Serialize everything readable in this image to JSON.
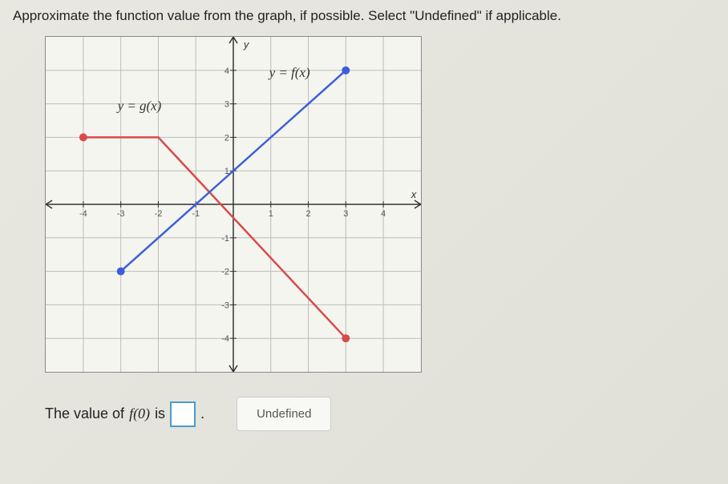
{
  "question": "Approximate the function value from the graph, if possible. Select \"Undefined\" if applicable.",
  "answer_prefix": "The value of ",
  "answer_func": "f(0)",
  "answer_mid": " is ",
  "answer_suffix": ".",
  "undefined_label": "Undefined",
  "chart_data": {
    "type": "line",
    "xlabel": "x",
    "ylabel": "y",
    "xlim": [
      -5,
      5
    ],
    "ylim": [
      -5,
      5
    ],
    "x_ticks": [
      -4,
      -3,
      -2,
      -1,
      1,
      2,
      3,
      4
    ],
    "y_ticks": [
      -4,
      -3,
      -2,
      -1,
      1,
      2,
      3,
      4
    ],
    "series": [
      {
        "name": "y = f(x)",
        "label_pos": [
          1.2,
          3.8
        ],
        "color": "#3b5fd9",
        "points": [
          [
            -3,
            -2
          ],
          [
            3,
            4
          ]
        ],
        "endpoints": [
          {
            "x": -3,
            "y": -2,
            "filled": true
          },
          {
            "x": 3,
            "y": 4,
            "filled": true
          }
        ]
      },
      {
        "name": "y = g(x)",
        "label_pos": [
          -3.2,
          3
        ],
        "color": "#d94a4a",
        "points": [
          [
            -4,
            2
          ],
          [
            -2,
            2
          ],
          [
            3,
            -4
          ]
        ],
        "endpoints": [
          {
            "x": -4,
            "y": 2,
            "filled": true
          },
          {
            "x": 3,
            "y": -4,
            "filled": true
          }
        ]
      }
    ]
  }
}
